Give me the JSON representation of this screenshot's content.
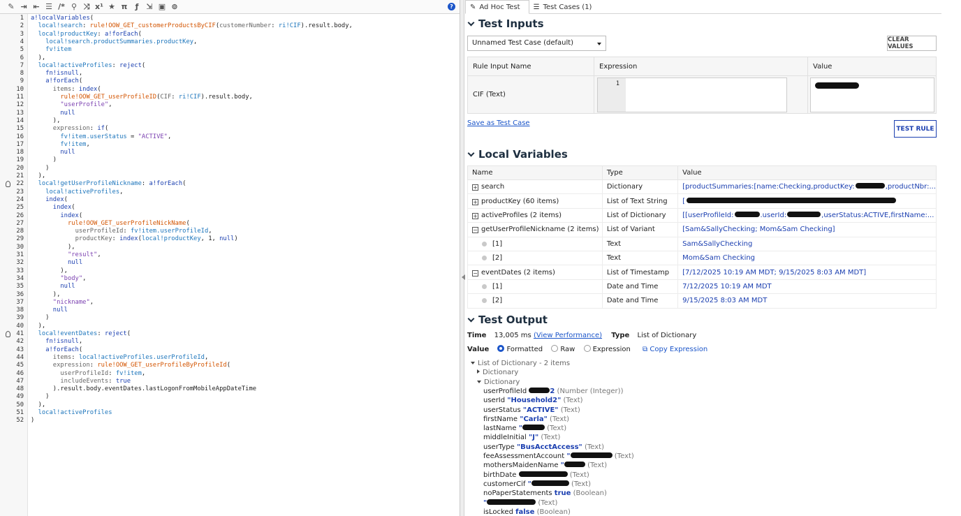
{
  "editor": {
    "toolbar_icons": [
      "wand-icon",
      "indent-icon",
      "outdent-icon",
      "list-icon",
      "comment-icon",
      "search-icon",
      "shuffle-icon",
      "fx-icon",
      "star-icon",
      "pi-icon",
      "function-icon",
      "import-icon",
      "image-icon",
      "scan-icon"
    ],
    "help": "?",
    "lines": [
      {
        "n": "1",
        "t": "a!localVariables("
      },
      {
        "n": "2",
        "t": "  local!search: rule!OOW_GET_customerProductsByCIF(customerNumber: ri!CIF).result.body,"
      },
      {
        "n": "3",
        "t": "  local!productKey: a!forEach("
      },
      {
        "n": "4",
        "t": "    local!search.productSummaries.productKey,"
      },
      {
        "n": "5",
        "t": "    fv!item"
      },
      {
        "n": "6",
        "t": "  ),"
      },
      {
        "n": "7",
        "t": "  local!activeProfiles: reject("
      },
      {
        "n": "8",
        "t": "    fn!isnull,"
      },
      {
        "n": "9",
        "t": "    a!forEach("
      },
      {
        "n": "10",
        "t": "      items: index("
      },
      {
        "n": "11",
        "t": "        rule!OOW_GET_userProfileID(CIF: ri!CIF).result.body,"
      },
      {
        "n": "12",
        "t": "        \"userProfile\","
      },
      {
        "n": "13",
        "t": "        null"
      },
      {
        "n": "14",
        "t": "      ),"
      },
      {
        "n": "15",
        "t": "      expression: if("
      },
      {
        "n": "16",
        "t": "        fv!item.userStatus = \"ACTIVE\","
      },
      {
        "n": "17",
        "t": "        fv!item,"
      },
      {
        "n": "18",
        "t": "        null"
      },
      {
        "n": "19",
        "t": "      )"
      },
      {
        "n": "20",
        "t": "    )"
      },
      {
        "n": "21",
        "t": "  ),"
      },
      {
        "n": "22",
        "t": "  local!getUserProfileNickname: a!forEach("
      },
      {
        "n": "23",
        "t": "    local!activeProfiles,"
      },
      {
        "n": "24",
        "t": "    index("
      },
      {
        "n": "25",
        "t": "      index("
      },
      {
        "n": "26",
        "t": "        index("
      },
      {
        "n": "27",
        "t": "          rule!OOW_GET_userProfileNickName("
      },
      {
        "n": "28",
        "t": "            userProfileId: fv!item.userProfileId,"
      },
      {
        "n": "29",
        "t": "            productKey: index(local!productKey, 1, null)"
      },
      {
        "n": "30",
        "t": "          ),"
      },
      {
        "n": "31",
        "t": "          \"result\","
      },
      {
        "n": "32",
        "t": "          null"
      },
      {
        "n": "33",
        "t": "        ),"
      },
      {
        "n": "34",
        "t": "        \"body\","
      },
      {
        "n": "35",
        "t": "        null"
      },
      {
        "n": "36",
        "t": "      ),"
      },
      {
        "n": "37",
        "t": "      \"nickname\","
      },
      {
        "n": "38",
        "t": "      null"
      },
      {
        "n": "39",
        "t": "    )"
      },
      {
        "n": "40",
        "t": "  ),"
      },
      {
        "n": "41",
        "t": "  local!eventDates: reject("
      },
      {
        "n": "42",
        "t": "    fn!isnull,"
      },
      {
        "n": "43",
        "t": "    a!forEach("
      },
      {
        "n": "44",
        "t": "      items: local!activeProfiles.userProfileId,"
      },
      {
        "n": "45",
        "t": "      expression: rule!OOW_GET_userProfileByProfileId("
      },
      {
        "n": "46",
        "t": "        userProfileId: fv!item,"
      },
      {
        "n": "47",
        "t": "        includeEvents: true"
      },
      {
        "n": "48",
        "t": "      ).result.body.eventDates.lastLogonFromMobileAppDateTime"
      },
      {
        "n": "49",
        "t": "    )"
      },
      {
        "n": "50",
        "t": "  ),"
      },
      {
        "n": "51",
        "t": "  local!activeProfiles"
      },
      {
        "n": "52",
        "t": ")"
      }
    ]
  },
  "tabs": [
    {
      "label": "Ad Hoc Test",
      "icon": "edit-icon"
    },
    {
      "label": "Test Cases (1)",
      "icon": "list-icon"
    }
  ],
  "test_inputs": {
    "title": "Test Inputs",
    "test_case_select": "Unnamed Test Case (default)",
    "clear_values": "CLEAR VALUES",
    "headers": [
      "Rule Input Name",
      "Expression",
      "Value"
    ],
    "row": {
      "name": "CIF (Text)",
      "line": "1"
    },
    "save_link": "Save as Test Case",
    "test_rule": "TEST RULE"
  },
  "local_variables": {
    "title": "Local Variables",
    "headers": [
      "Name",
      "Type",
      "Value"
    ],
    "rows": [
      {
        "name": "search",
        "type": "Dictionary",
        "value": "[productSummaries:[name:Checking,productKey:",
        "value2": ",productNbr:...",
        "kind": "plus"
      },
      {
        "name": "productKey (60 items)",
        "type": "List of Text String",
        "value": "[",
        "value2": "",
        "kind": "plus"
      },
      {
        "name": "activeProfiles (2 items)",
        "type": "List of Dictionary",
        "value": "[[userProfileId:",
        "value2": ",userStatus:ACTIVE,firstName:...",
        "kind": "plus"
      },
      {
        "name": "getUserProfileNickname (2 items)",
        "type": "List of Variant",
        "value": "[Sam&SallyChecking; Mom&Sam Checking]",
        "value2": "",
        "kind": "minus"
      },
      {
        "name": "[1]",
        "type": "Text",
        "value": "Sam&SallyChecking",
        "value2": "",
        "kind": "dot"
      },
      {
        "name": "[2]",
        "type": "Text",
        "value": "Mom&Sam Checking",
        "value2": "",
        "kind": "dot"
      },
      {
        "name": "eventDates (2 items)",
        "type": "List of Timestamp",
        "value": "[7/12/2025 10:19 AM MDT; 9/15/2025 8:03 AM MDT]",
        "value2": "",
        "kind": "minus"
      },
      {
        "name": "[1]",
        "type": "Date and Time",
        "value": "7/12/2025 10:19 AM MDT",
        "value2": "",
        "kind": "dot"
      },
      {
        "name": "[2]",
        "type": "Date and Time",
        "value": "9/15/2025 8:03 AM MDT",
        "value2": "",
        "kind": "dot"
      }
    ],
    "userid_label": ".userId:"
  },
  "test_output": {
    "title": "Test Output",
    "time_label": "Time",
    "time_value": "13,005 ms",
    "view_perf": "(View Performance)",
    "type_label": "Type",
    "type_value": "List of Dictionary",
    "value_label": "Value",
    "radio_formatted": "Formatted",
    "radio_raw": "Raw",
    "radio_expression": "Expression",
    "copy_expression": "Copy Expression",
    "tree": {
      "root": "List of Dictionary - 2 items",
      "dict1": "Dictionary",
      "dict2": "Dictionary",
      "fields": [
        {
          "key": "userProfileId",
          "val": "",
          "type": "(Number (Integer))",
          "suffix": "2"
        },
        {
          "key": "userId",
          "val": "\"Household2\"",
          "type": "(Text)"
        },
        {
          "key": "userStatus",
          "val": "\"ACTIVE\"",
          "type": "(Text)"
        },
        {
          "key": "firstName",
          "val": "\"Carla\"",
          "type": "(Text)"
        },
        {
          "key": "lastName",
          "val": "\"",
          "type": "(Text)"
        },
        {
          "key": "middleInitial",
          "val": "\"J\"",
          "type": "(Text)"
        },
        {
          "key": "userType",
          "val": "\"BusAcctAccess\"",
          "type": "(Text)"
        },
        {
          "key": "feeAssessmentAccount",
          "val": "\"",
          "type": "(Text)"
        },
        {
          "key": "mothersMaidenName",
          "val": "\"",
          "type": "(Text)"
        },
        {
          "key": "birthDate",
          "val": "",
          "type": "(Text)"
        },
        {
          "key": "customerCif",
          "val": "\"",
          "type": "(Text)"
        },
        {
          "key": "noPaperStatements",
          "val": "true",
          "type": "(Boolean)"
        },
        {
          "key": "",
          "val": "\"",
          "type": "(Text)"
        },
        {
          "key": "isLocked",
          "val": "false",
          "type": "(Boolean)"
        }
      ]
    }
  }
}
